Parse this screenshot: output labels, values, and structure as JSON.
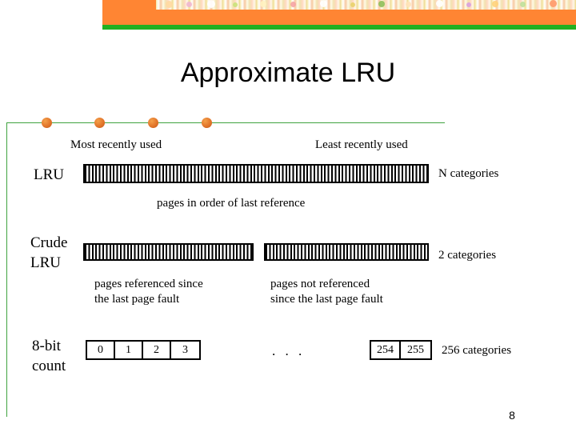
{
  "slide": {
    "title": "Approximate LRU",
    "page_number": "8",
    "theme": {
      "header_orange": "#FF8533",
      "header_green": "#22B022",
      "rule_green": "#3FA33F",
      "bullet_orange": "#E2752A",
      "text_black": "#000000",
      "background": "#FFFFFF"
    }
  },
  "bullets": {
    "count": 4,
    "positions": [
      58,
      124,
      191,
      258
    ]
  },
  "labels": {
    "most_recently_used": "Most recently used",
    "least_recently_used": "Least recently used",
    "pages_in_order": "pages in order of last reference",
    "pages_referenced_since": "pages referenced since\nthe last page fault",
    "pages_not_referenced": "pages not referenced\nsince the last page fault",
    "ellipsis": ". . ."
  },
  "rows": [
    {
      "name": "lru",
      "label": "LRU",
      "categories_label": "N categories",
      "bars": [
        {
          "name": "lru-full-bar"
        }
      ]
    },
    {
      "name": "crude-lru",
      "label": "Crude\nLRU",
      "categories_label": "2 categories",
      "bars": [
        {
          "name": "crude-referenced-bar"
        },
        {
          "name": "crude-not-referenced-bar"
        }
      ]
    },
    {
      "name": "eight-bit-count",
      "label": "8-bit\ncount",
      "categories_label": "256 categories",
      "cells_low": [
        "0",
        "1",
        "2",
        "3"
      ],
      "cells_high": [
        "254",
        "255"
      ]
    }
  ]
}
